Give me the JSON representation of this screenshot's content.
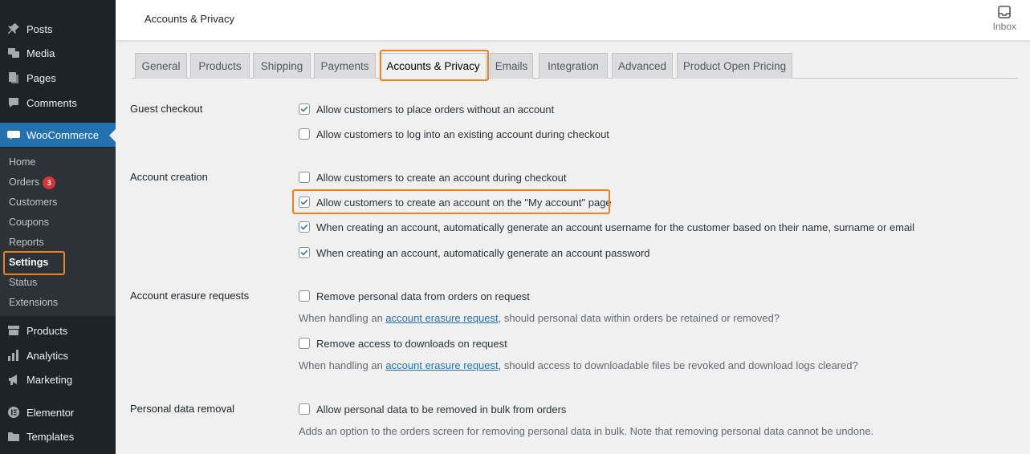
{
  "sidebar": {
    "items": [
      {
        "label": "Posts",
        "icon": "pin-icon"
      },
      {
        "label": "Media",
        "icon": "media-icon"
      },
      {
        "label": "Pages",
        "icon": "pages-icon"
      },
      {
        "label": "Comments",
        "icon": "comments-icon"
      },
      {
        "label": "WooCommerce",
        "icon": "woo-icon"
      },
      {
        "label": "Products",
        "icon": "products-icon"
      },
      {
        "label": "Analytics",
        "icon": "analytics-icon"
      },
      {
        "label": "Marketing",
        "icon": "marketing-icon"
      },
      {
        "label": "Elementor",
        "icon": "elementor-icon"
      },
      {
        "label": "Templates",
        "icon": "folder-icon"
      }
    ],
    "submenu": [
      {
        "label": "Home"
      },
      {
        "label": "Orders",
        "badge": "3"
      },
      {
        "label": "Customers"
      },
      {
        "label": "Coupons"
      },
      {
        "label": "Reports"
      },
      {
        "label": "Settings"
      },
      {
        "label": "Status"
      },
      {
        "label": "Extensions"
      }
    ]
  },
  "header": {
    "title": "Accounts & Privacy",
    "inbox_label": "Inbox"
  },
  "tabs": [
    {
      "label": "General"
    },
    {
      "label": "Products"
    },
    {
      "label": "Shipping"
    },
    {
      "label": "Payments"
    },
    {
      "label": "Accounts & Privacy"
    },
    {
      "label": "Emails"
    },
    {
      "label": "Integration"
    },
    {
      "label": "Advanced"
    },
    {
      "label": "Product Open Pricing"
    }
  ],
  "sections": {
    "guest_checkout": {
      "label": "Guest checkout",
      "options": [
        {
          "label": "Allow customers to place orders without an account",
          "checked": true
        },
        {
          "label": "Allow customers to log into an existing account during checkout",
          "checked": false
        }
      ]
    },
    "account_creation": {
      "label": "Account creation",
      "options": [
        {
          "label": "Allow customers to create an account during checkout",
          "checked": false
        },
        {
          "label": "Allow customers to create an account on the \"My account\" page",
          "checked": true
        },
        {
          "label": "When creating an account, automatically generate an account username for the customer based on their name, surname or email",
          "checked": true
        },
        {
          "label": "When creating an account, automatically generate an account password",
          "checked": true
        }
      ]
    },
    "erasure": {
      "label": "Account erasure requests",
      "options": [
        {
          "label": "Remove personal data from orders on request",
          "checked": false
        },
        {
          "label": "Remove access to downloads on request",
          "checked": false
        }
      ],
      "desc1_pre": "When handling an ",
      "desc1_link": "account erasure request",
      "desc1_post": ", should personal data within orders be retained or removed?",
      "desc2_pre": "When handling an ",
      "desc2_link": "account erasure request",
      "desc2_post": ", should access to downloadable files be revoked and download logs cleared?"
    },
    "removal": {
      "label": "Personal data removal",
      "options": [
        {
          "label": "Allow personal data to be removed in bulk from orders",
          "checked": false
        }
      ],
      "desc": "Adds an option to the orders screen for removing personal data in bulk. Note that removing personal data cannot be undone."
    }
  },
  "colors": {
    "accent": "#2271b1",
    "highlight": "#f0821e",
    "sidebar_bg": "#1d2327",
    "badge": "#d63638"
  }
}
